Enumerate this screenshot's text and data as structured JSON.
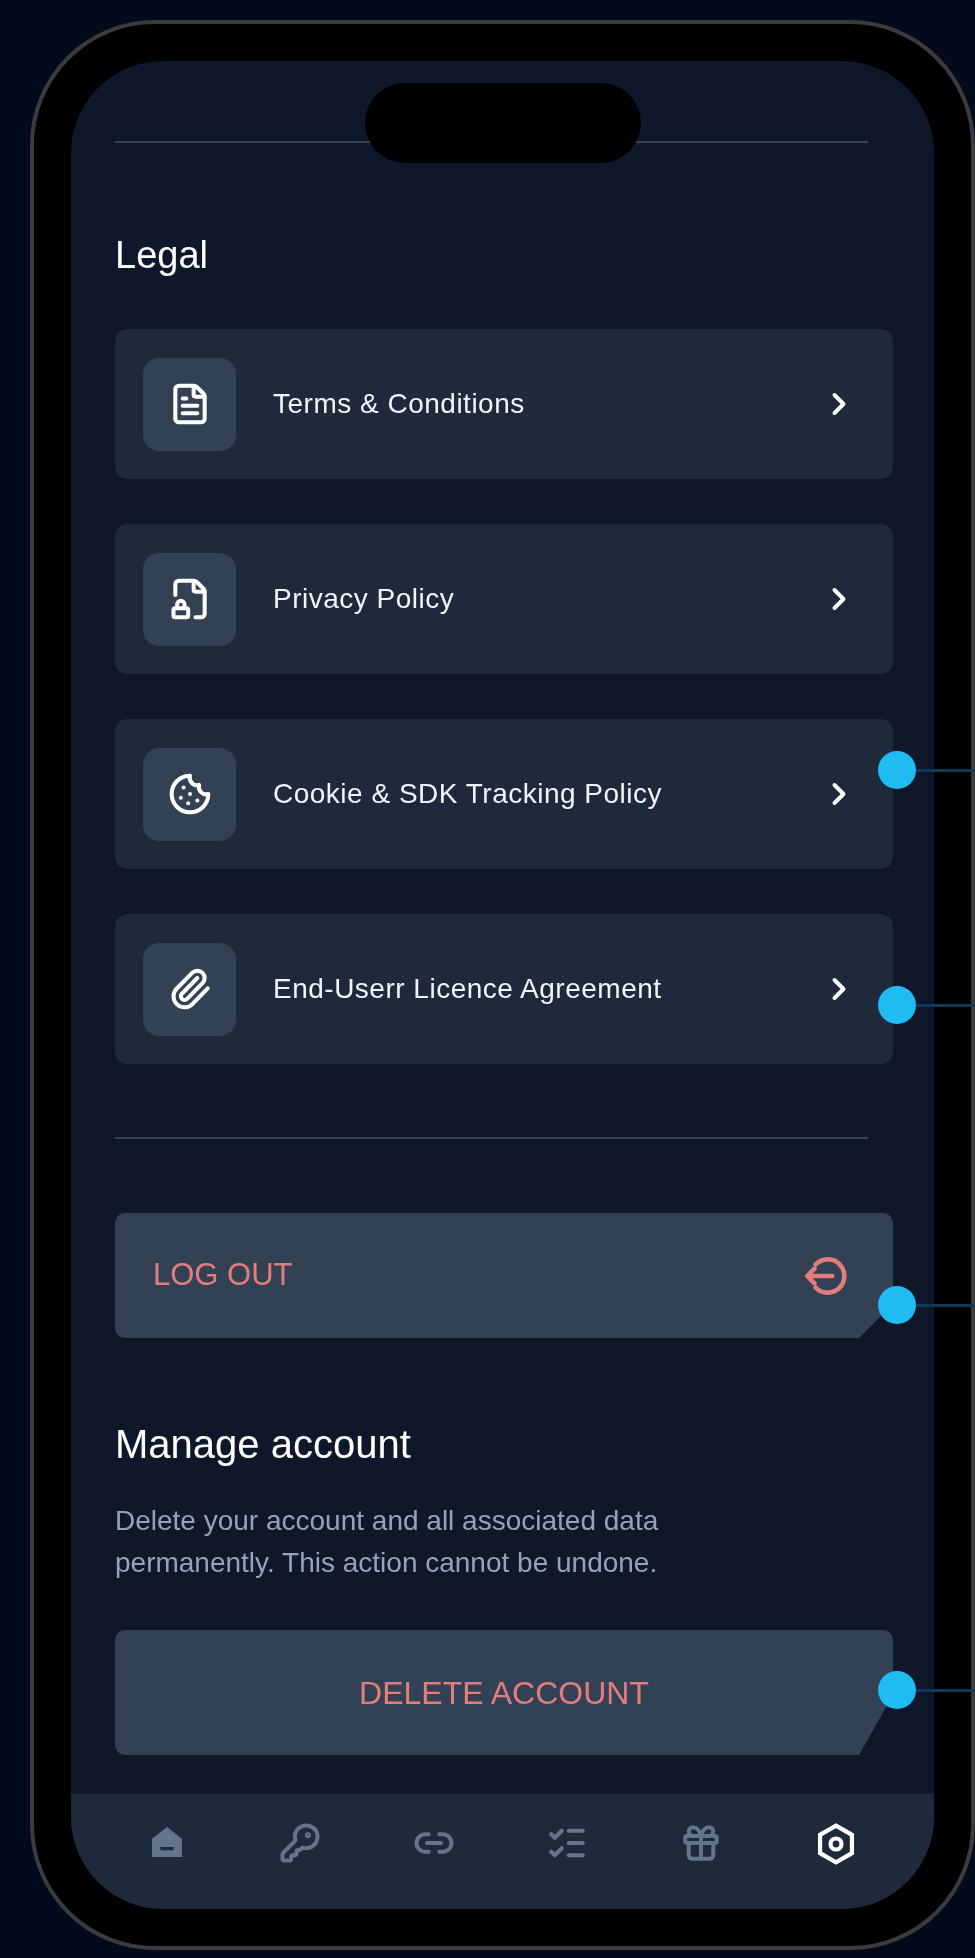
{
  "legal": {
    "title": "Legal",
    "items": [
      {
        "label": "Terms & Conditions"
      },
      {
        "label": "Privacy Policy"
      },
      {
        "label": "Cookie & SDK Tracking Policy"
      },
      {
        "label": "End-Userr Licence Agreement"
      }
    ]
  },
  "logout_button": {
    "label": "LOG OUT"
  },
  "manage_account": {
    "title": "Manage account",
    "description": "Delete your account and all associated data permanently. This action cannot be undone.",
    "button": "DELETE ACCOUNT"
  },
  "tab_bar": [
    {
      "selected": false
    },
    {
      "selected": false
    },
    {
      "selected": false
    },
    {
      "selected": false
    },
    {
      "selected": false
    },
    {
      "selected": true
    }
  ]
}
